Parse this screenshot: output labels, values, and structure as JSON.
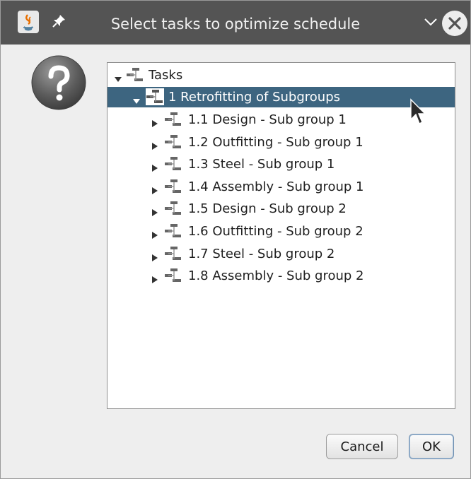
{
  "window": {
    "title": "Select tasks to optimize schedule",
    "icons": {
      "app": "java-app-icon",
      "pin": "pin-icon",
      "minimize": "chevron-down-icon",
      "close": "close-icon"
    }
  },
  "dialog": {
    "icon": "question-icon"
  },
  "tree": {
    "root": {
      "label": "Tasks",
      "expanded": true
    },
    "group": {
      "label": "1 Retrofitting of Subgroups",
      "expanded": true,
      "selected": true
    },
    "items": [
      {
        "label": "1.1 Design - Sub group 1"
      },
      {
        "label": "1.2 Outfitting - Sub group 1"
      },
      {
        "label": "1.3 Steel - Sub group 1"
      },
      {
        "label": "1.4 Assembly - Sub group 1"
      },
      {
        "label": "1.5 Design - Sub group 2"
      },
      {
        "label": "1.6 Outfitting - Sub group 2"
      },
      {
        "label": "1.7 Steel - Sub group 2"
      },
      {
        "label": "1.8 Assembly - Sub group 2"
      }
    ]
  },
  "buttons": {
    "cancel": "Cancel",
    "ok": "OK"
  },
  "colors": {
    "titlebar": "#545454",
    "selection": "#3d6580",
    "dialog_bg": "#eeeeee"
  }
}
